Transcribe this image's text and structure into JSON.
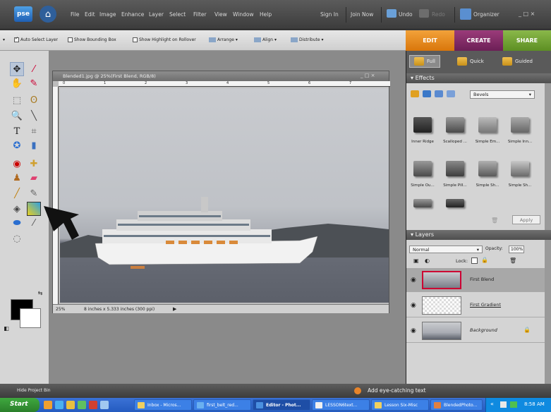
{
  "app": {
    "logo": "pse",
    "menus": [
      "File",
      "Edit",
      "Image",
      "Enhance",
      "Layer",
      "Select",
      "Filter",
      "View",
      "Window",
      "Help"
    ],
    "sign_in": "Sign In",
    "join_now": "Join Now",
    "undo": "Undo",
    "redo": "Redo",
    "organizer": "Organizer",
    "window_controls": "_ □ ×"
  },
  "options_bar": {
    "auto_select_layer": "Auto Select Layer",
    "show_bounding_box": "Show Bounding Box",
    "show_highlight": "Show Highlight on Rollover",
    "arrange": "Arrange ▾",
    "align": "Align ▾",
    "distribute": "Distribute ▾"
  },
  "tabs": {
    "edit": "EDIT",
    "create": "CREATE",
    "share": "SHARE"
  },
  "modes": {
    "full": "Full",
    "quick": "Quick",
    "guided": "Guided"
  },
  "document": {
    "title": "Blended1.jpg @ 25%(First Blend, RGB/8)",
    "controls": "_ □ ×",
    "ruler_ticks": [
      "0",
      "1",
      "2",
      "3",
      "4",
      "5",
      "6",
      "7"
    ],
    "zoom": "25%",
    "size_info": "8 inches x 5.333 inches (300 ppi)"
  },
  "effects": {
    "header": "Effects",
    "select_value": "Bevels",
    "items": [
      "Inner Ridge",
      "Scalloped ...",
      "Simple Em...",
      "Simple Inn...",
      "Simple Ou...",
      "Simple Pill...",
      "Simple Sh...",
      "Simple Sh..."
    ],
    "apply": "Apply"
  },
  "layers": {
    "header": "Layers",
    "blend_mode": "Normal",
    "opacity_label": "Opacity:",
    "opacity_value": "100%",
    "lock_label": "Lock:",
    "items": [
      {
        "name": "First Blend",
        "selected": true
      },
      {
        "name": "First Gradient",
        "selected": false
      },
      {
        "name": "Background",
        "selected": false
      }
    ]
  },
  "project_bin": {
    "hide": "Hide Project Bin",
    "tip": "Add eye-catching text"
  },
  "taskbar": {
    "start": "Start",
    "tasks": [
      "Inbox - Micros...",
      "first_belt_red...",
      "Editor - Phot...",
      "LESSON6text...",
      "Lesson Six-Misc",
      "BlendedPhoto..."
    ],
    "clock": "8:58 AM"
  }
}
